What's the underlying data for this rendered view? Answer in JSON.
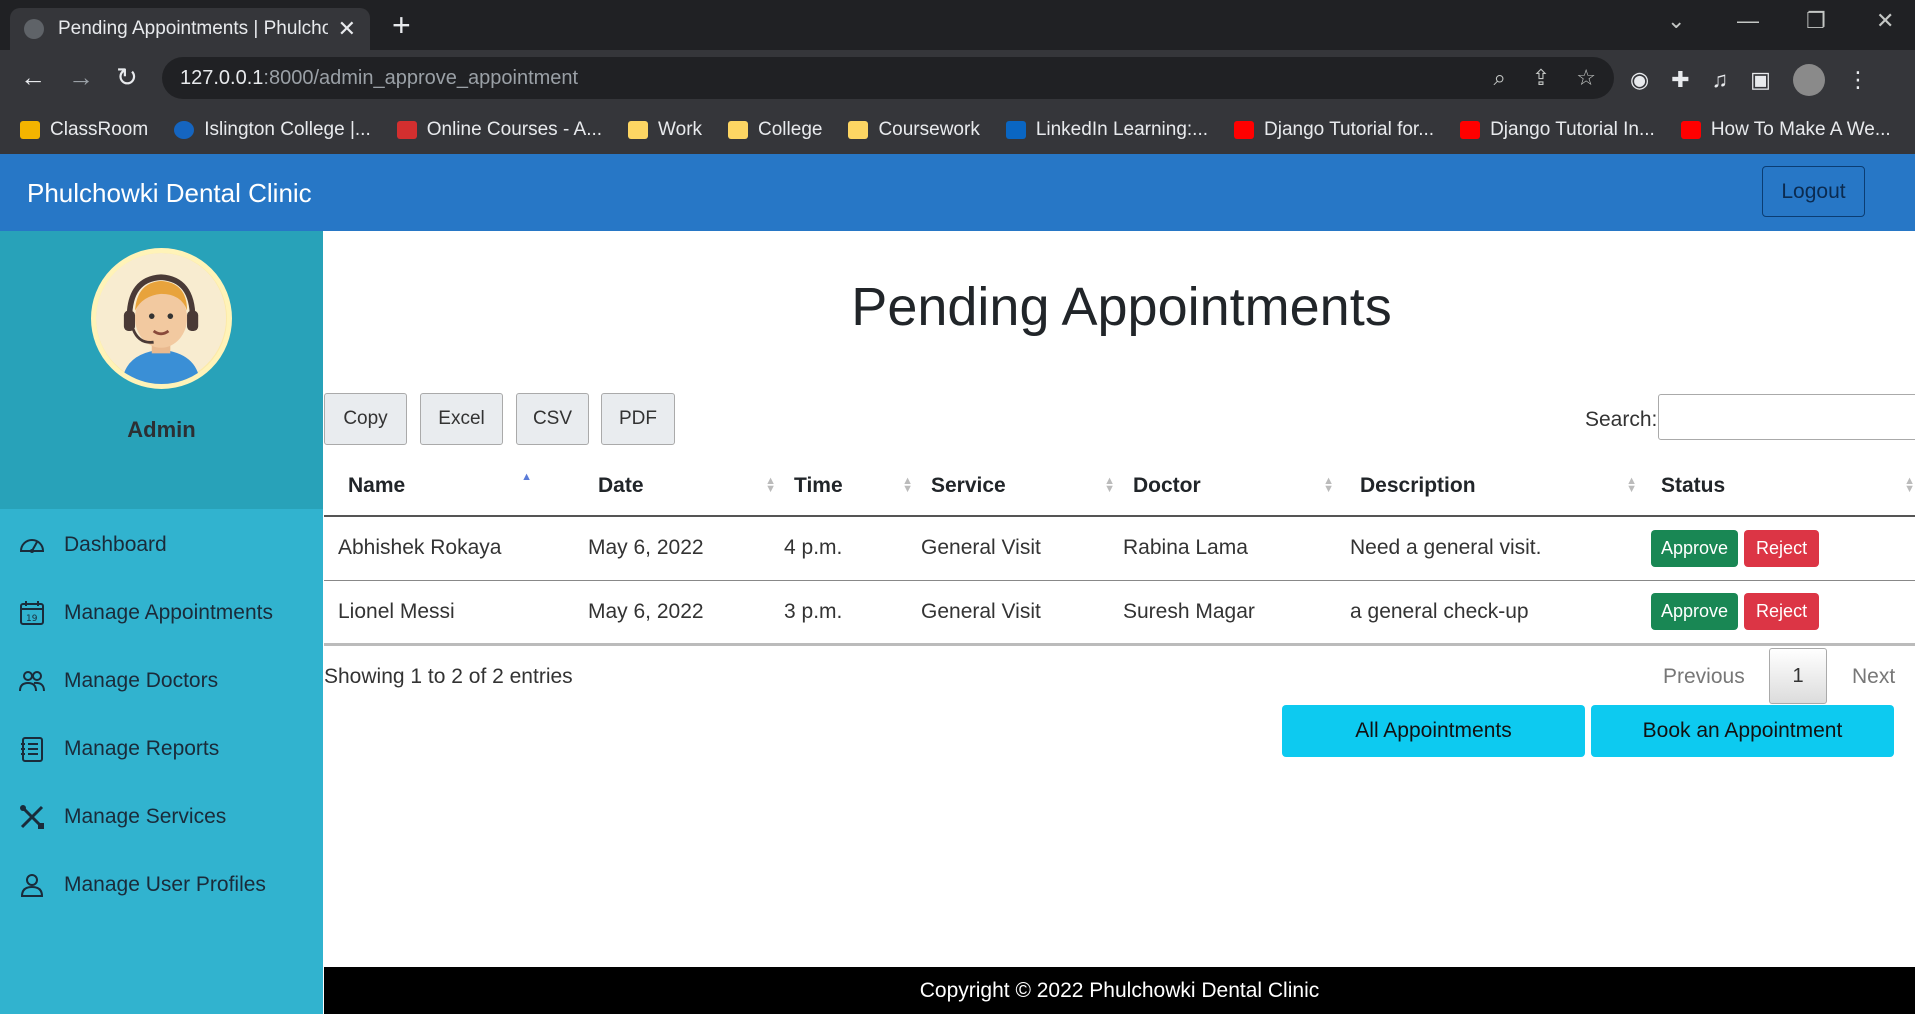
{
  "browser": {
    "tab_title": "Pending Appointments | Phulchowki",
    "url_host": "127.0.0.1",
    "url_path": ":8000/admin_approve_appointment",
    "bookmarks": [
      {
        "label": "ClassRoom",
        "icon": "classroom-icon",
        "color": "#f4b400"
      },
      {
        "label": "Islington College |...",
        "icon": "islington-icon",
        "color": "#1565c0"
      },
      {
        "label": "Online Courses - A...",
        "icon": "udemy-icon",
        "color": "#d32f2f"
      },
      {
        "label": "Work",
        "icon": "folder-icon",
        "color": "#fdd663"
      },
      {
        "label": "College",
        "icon": "folder-icon",
        "color": "#fdd663"
      },
      {
        "label": "Coursework",
        "icon": "folder-icon",
        "color": "#fdd663"
      },
      {
        "label": "LinkedIn Learning:...",
        "icon": "linkedin-icon",
        "color": "#0a66c2"
      },
      {
        "label": "Django Tutorial for...",
        "icon": "youtube-icon",
        "color": "#ff0000"
      },
      {
        "label": "Django Tutorial In...",
        "icon": "youtube-icon",
        "color": "#ff0000"
      },
      {
        "label": "How To Make A We...",
        "icon": "youtube-icon",
        "color": "#ff0000"
      }
    ]
  },
  "navbar": {
    "brand": "Phulchowki Dental Clinic",
    "logout_label": "Logout"
  },
  "sidebar": {
    "profile_name": "Admin",
    "items": [
      {
        "label": "Dashboard",
        "icon": "dashboard-icon"
      },
      {
        "label": "Manage Appointments",
        "icon": "calendar-icon"
      },
      {
        "label": "Manage Doctors",
        "icon": "people-icon"
      },
      {
        "label": "Manage Reports",
        "icon": "report-icon"
      },
      {
        "label": "Manage Services",
        "icon": "tools-icon"
      },
      {
        "label": "Manage User Profiles",
        "icon": "person-icon"
      }
    ]
  },
  "main": {
    "title": "Pending Appointments",
    "export_buttons": [
      "Copy",
      "Excel",
      "CSV",
      "PDF"
    ],
    "search_label": "Search:",
    "search_value": "",
    "columns": [
      "Name",
      "Date",
      "Time",
      "Service",
      "Doctor",
      "Description",
      "Status"
    ],
    "rows": [
      {
        "name": "Abhishek Rokaya",
        "date": "May 6, 2022",
        "time": "4 p.m.",
        "service": "General Visit",
        "doctor": "Rabina Lama",
        "description": "Need a general visit.",
        "approve": "Approve",
        "reject": "Reject"
      },
      {
        "name": "Lionel Messi",
        "date": "May 6, 2022",
        "time": "3 p.m.",
        "service": "General Visit",
        "doctor": "Suresh Magar",
        "description": "a general check-up",
        "approve": "Approve",
        "reject": "Reject"
      }
    ],
    "info": "Showing 1 to 2 of 2 entries",
    "pager": {
      "previous": "Previous",
      "page": "1",
      "next": "Next"
    },
    "all_appointments_label": "All Appointments",
    "book_label": "Book an Appointment"
  },
  "footer": {
    "text": "Copyright © 2022 Phulchowki Dental Clinic"
  },
  "colors": {
    "navbar": "#2777c6",
    "sidebar": "#31b3cf",
    "approve": "#198754",
    "reject": "#dc3545",
    "action": "#0dcaf0"
  }
}
